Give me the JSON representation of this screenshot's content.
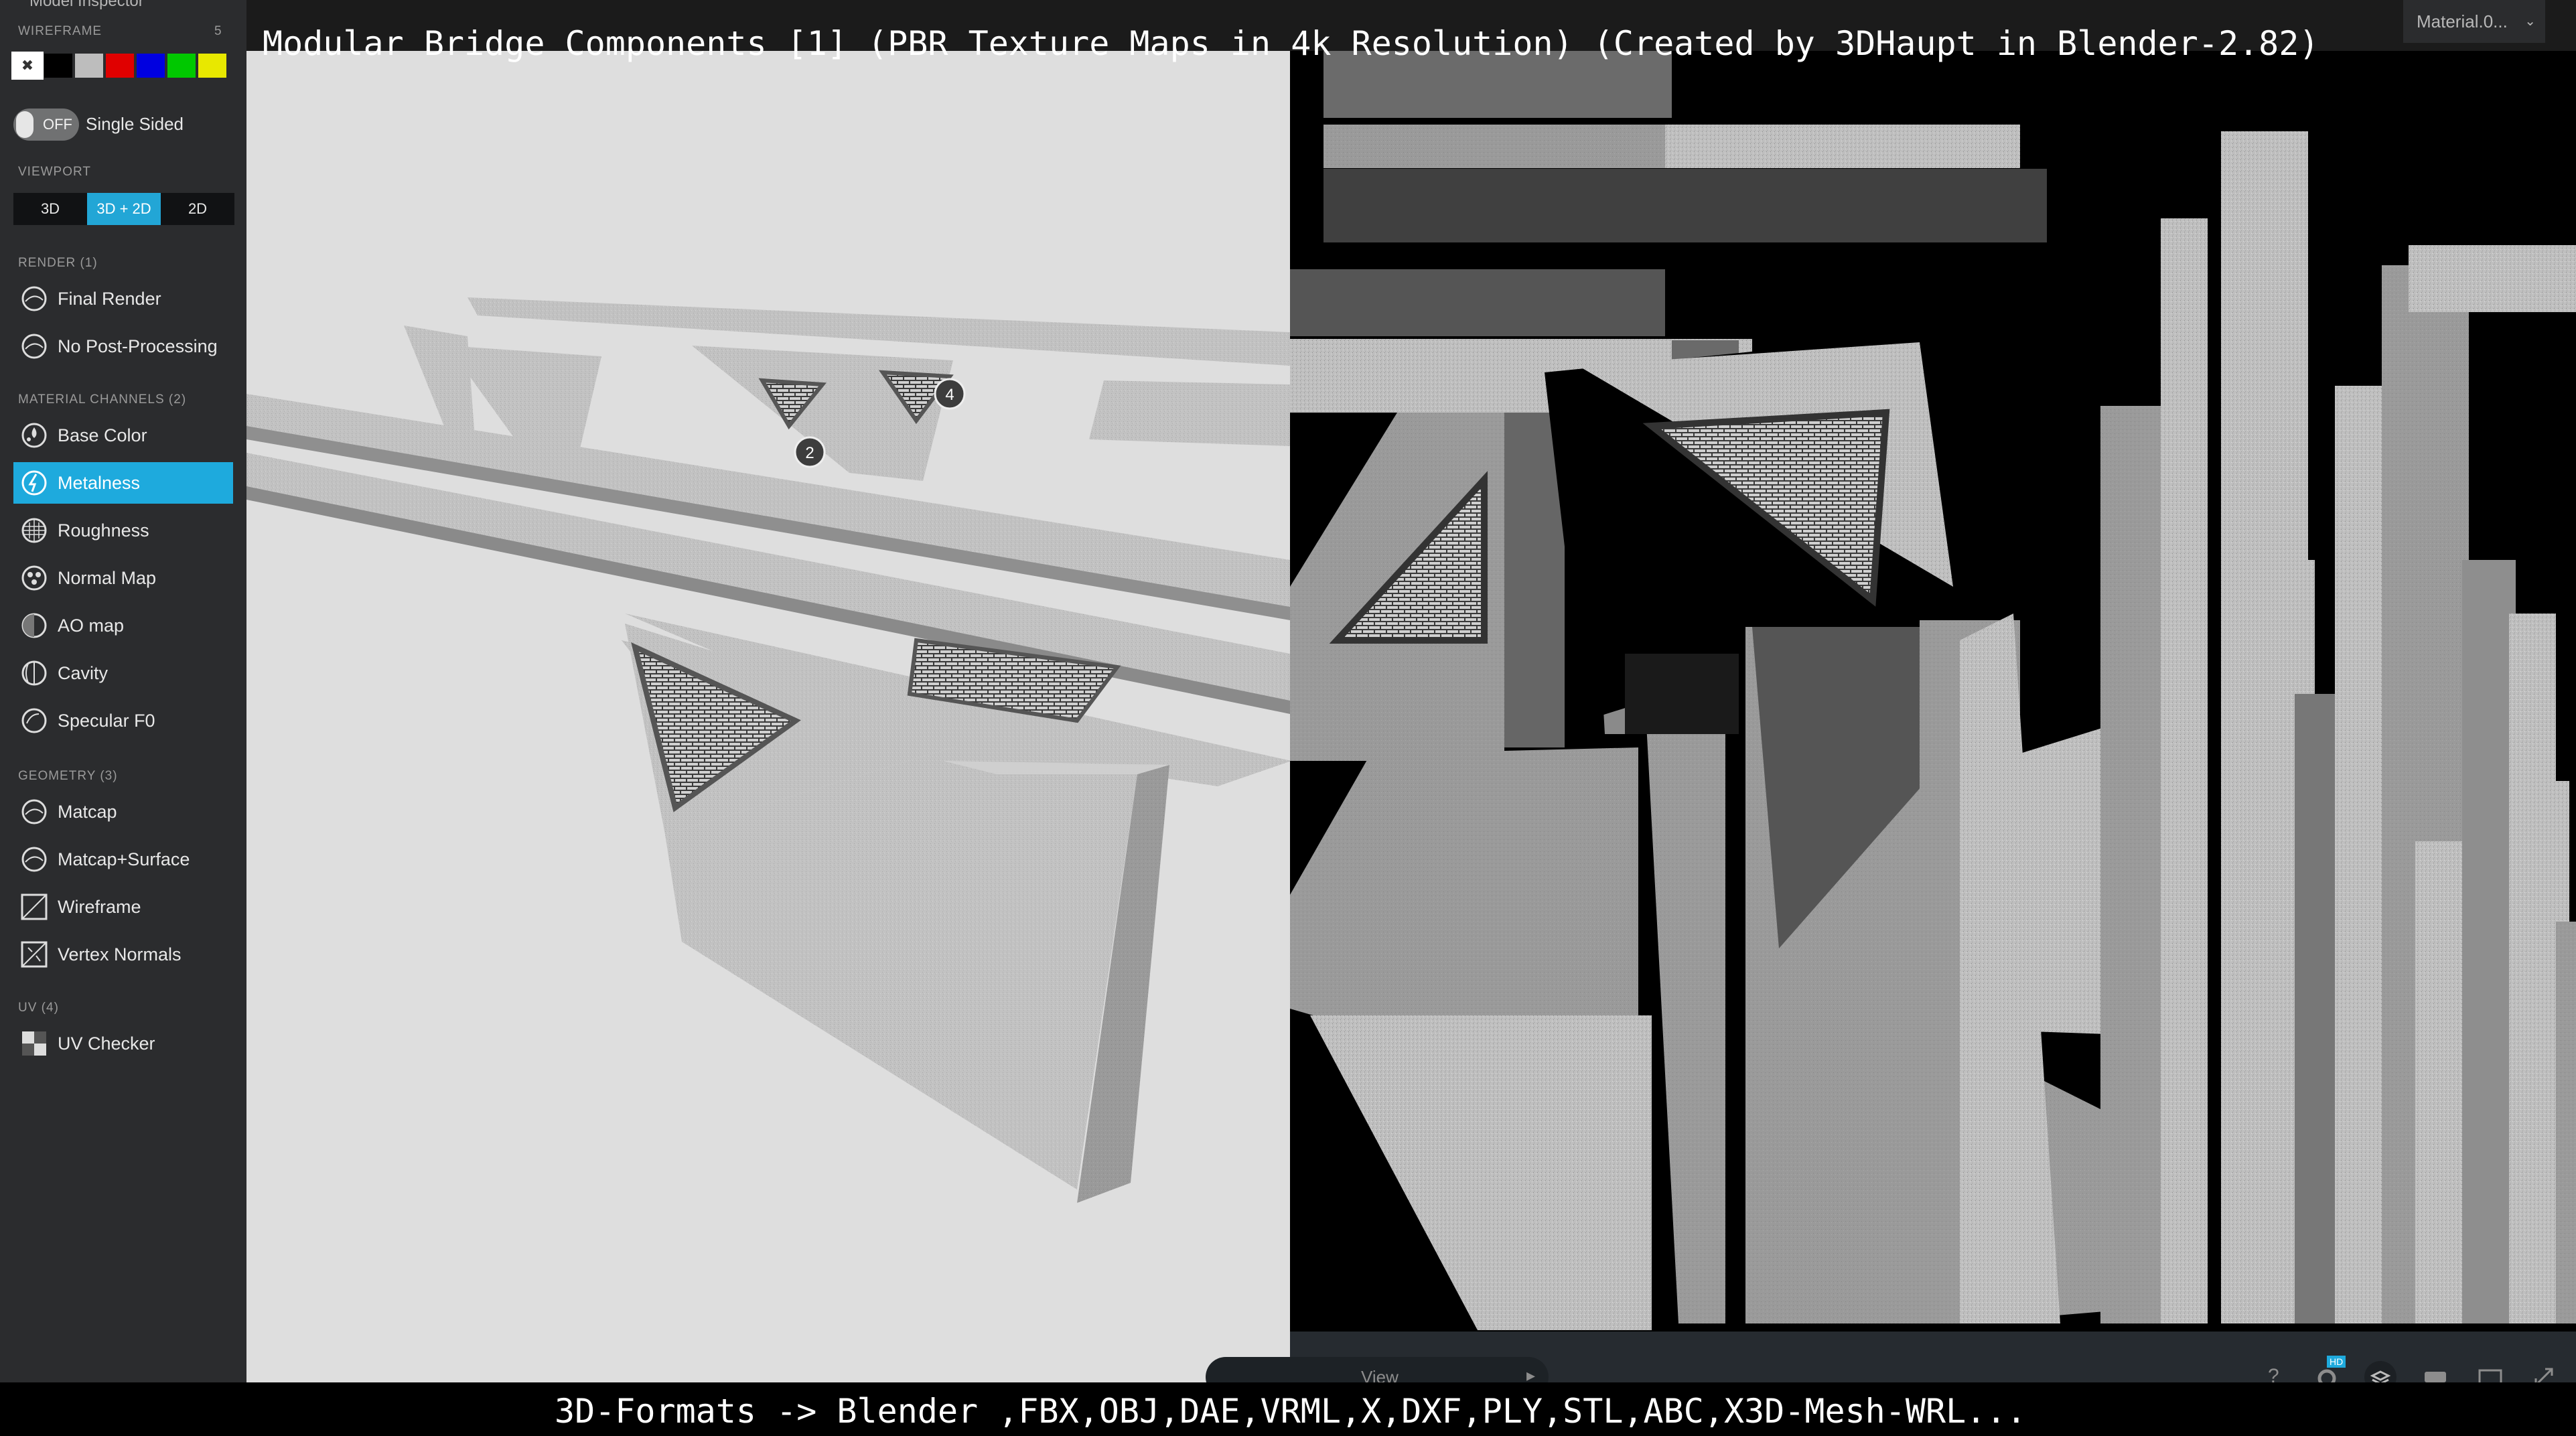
{
  "window": {
    "title": "Modular Bridge Components [1] (PBR Texture Maps in 4k Resolution) (Created by 3DHaupt in Blender-2.82)",
    "inspector_title": "Model Inspector"
  },
  "sidebar": {
    "wireframe_label": "WIREFRAME",
    "wireframe_count": "5",
    "wireframe_colors": [
      "#ffffff",
      "#000000",
      "#bdbdbd",
      "#e00000",
      "#0000e0",
      "#00c800",
      "#e8e800"
    ],
    "single_sided": {
      "state": "OFF",
      "label": "Single Sided"
    },
    "viewport": {
      "label": "VIEWPORT",
      "options": [
        "3D",
        "3D + 2D",
        "2D"
      ],
      "selected": "3D + 2D"
    },
    "render": {
      "label": "RENDER (1)",
      "items": [
        {
          "label": "Final Render",
          "icon": "sphere-icon"
        },
        {
          "label": "No Post-Processing",
          "icon": "sphere-icon"
        }
      ]
    },
    "material_channels": {
      "label": "MATERIAL CHANNELS (2)",
      "items": [
        {
          "label": "Base Color",
          "icon": "color-drops-icon"
        },
        {
          "label": "Metalness",
          "icon": "metal-sphere-icon",
          "active": true
        },
        {
          "label": "Roughness",
          "icon": "rough-sphere-icon"
        },
        {
          "label": "Normal Map",
          "icon": "normal-sphere-icon"
        },
        {
          "label": "AO map",
          "icon": "ao-sphere-icon"
        },
        {
          "label": "Cavity",
          "icon": "cavity-sphere-icon"
        },
        {
          "label": "Specular F0",
          "icon": "specular-sphere-icon"
        }
      ]
    },
    "geometry": {
      "label": "GEOMETRY (3)",
      "items": [
        {
          "label": "Matcap",
          "icon": "matcap-sphere-icon"
        },
        {
          "label": "Matcap+Surface",
          "icon": "matcap-surface-icon"
        },
        {
          "label": "Wireframe",
          "icon": "wireframe-icon"
        },
        {
          "label": "Vertex Normals",
          "icon": "vertex-normals-icon"
        }
      ]
    },
    "uv": {
      "label": "UV (4)",
      "items": [
        {
          "label": "UV Checker",
          "icon": "checker-icon"
        }
      ]
    }
  },
  "viewport3d": {
    "annotations": [
      "2",
      "4"
    ]
  },
  "texture_panel": {
    "material_select": "Material.0...",
    "view_label": "View",
    "toolbar_icons": [
      "help-icon",
      "hd-settings-icon",
      "layers-icon",
      "vr-icon",
      "aspect-ratio-icon",
      "fullscreen-icon"
    ],
    "hd_badge": "HD"
  },
  "footer": {
    "formats": "3D-Formats -> Blender ,FBX,OBJ,DAE,VRML,X,DXF,PLY,STL,ABC,X3D-Mesh-WRL..."
  },
  "colors": {
    "accent": "#1eaadd",
    "sidebar_bg": "#2b2c2e",
    "viewport_bg": "#dcdcdc"
  }
}
